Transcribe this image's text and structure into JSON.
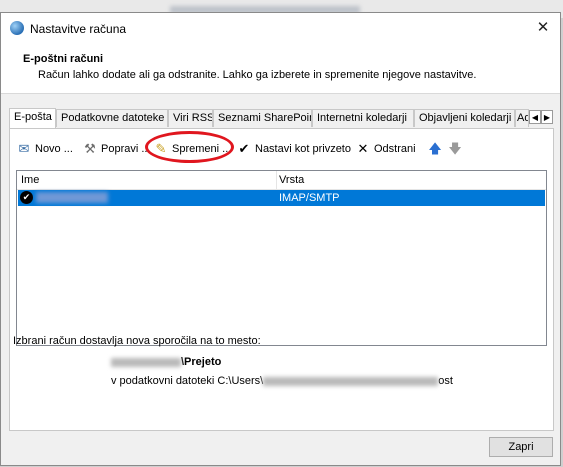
{
  "window": {
    "title": "Nastavitve računa",
    "close_glyph": "✕"
  },
  "header": {
    "title": "E-poštni računi",
    "description": "Račun lahko dodate ali ga odstranite. Lahko ga izberete in spremenite njegove nastavitve."
  },
  "tabs": [
    {
      "label": "E-pošta"
    },
    {
      "label": "Podatkovne datoteke"
    },
    {
      "label": "Viri RSS"
    },
    {
      "label": "Seznami SharePoint"
    },
    {
      "label": "Internetni koledarji"
    },
    {
      "label": "Objavljeni koledarji"
    },
    {
      "label": "Ad"
    }
  ],
  "toolbar": {
    "new_label": "Novo ...",
    "repair_label": "Popravi ...",
    "change_label": "Spremeni ...",
    "set_default_label": "Nastavi kot privzeto",
    "remove_label": "Odstrani"
  },
  "list": {
    "col_name": "Ime",
    "col_type": "Vrsta",
    "rows": [
      {
        "type": "IMAP/SMTP"
      }
    ]
  },
  "delivery": {
    "label": "Izbrani račun dostavlja nova sporočila na to mesto:",
    "folder": "\\Prejeto",
    "file_prefix": "v podatkovni datoteki C:\\Users\\",
    "file_suffix": "ost"
  },
  "buttons": {
    "close": "Zapri"
  },
  "colors": {
    "selection": "#0078d7",
    "annotation": "#e0161e"
  }
}
